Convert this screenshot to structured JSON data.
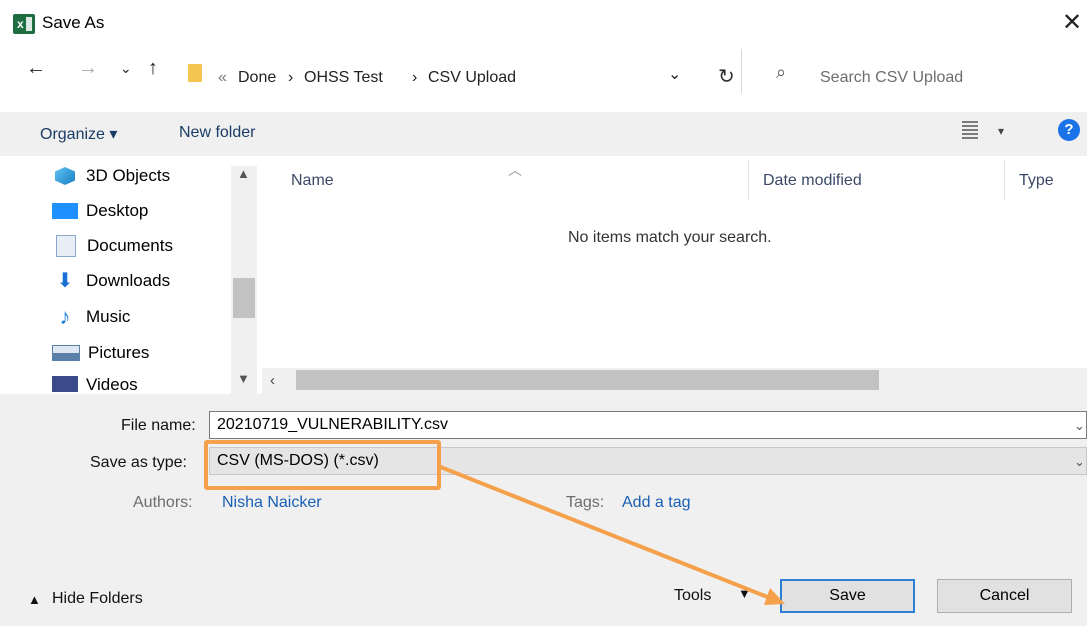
{
  "window": {
    "title": "Save As",
    "app_icon": "excel-icon",
    "close_glyph": "✕"
  },
  "nav": {
    "back": "←",
    "forward": "→",
    "recent": "⌄",
    "up": "↑",
    "breadcrumb_sep": "«",
    "crumbs": [
      "Done",
      "OHSS Test",
      "CSV Upload"
    ],
    "crumb_arrow": "›",
    "dropdown": "⌄",
    "refresh": "↻",
    "search_placeholder": "Search CSV Upload"
  },
  "toolbar": {
    "organize": "Organize ▾",
    "new_folder": "New folder",
    "help": "?"
  },
  "sidebar": {
    "items": [
      {
        "label": "3D Objects",
        "icon": "3d-objects-icon",
        "color": "#2b9fd8"
      },
      {
        "label": "Desktop",
        "icon": "desktop-icon",
        "color": "#1e90ff"
      },
      {
        "label": "Documents",
        "icon": "documents-icon",
        "color": "#8aa6c8"
      },
      {
        "label": "Downloads",
        "icon": "downloads-icon",
        "color": "#1a6fd4"
      },
      {
        "label": "Music",
        "icon": "music-icon",
        "color": "#1e7fd8"
      },
      {
        "label": "Pictures",
        "icon": "pictures-icon",
        "color": "#5a7fa8"
      },
      {
        "label": "Videos",
        "icon": "videos-icon",
        "color": "#3a4a8a"
      }
    ]
  },
  "filelist": {
    "columns": [
      "Name",
      "Date modified",
      "Type"
    ],
    "empty_message": "No items match your search."
  },
  "form": {
    "file_name_label": "File name:",
    "file_name_value": "20210719_VULNERABILITY.csv",
    "save_type_label": "Save as type:",
    "save_type_value": "CSV (MS-DOS) (*.csv)",
    "authors_label": "Authors:",
    "authors_value": "Nisha Naicker",
    "tags_label": "Tags:",
    "tags_value": "Add a tag"
  },
  "footer": {
    "hide_folders": "Hide Folders",
    "tools": "Tools",
    "save": "Save",
    "cancel": "Cancel"
  },
  "colors": {
    "annotation": "#f5a04a",
    "accent": "#2a7fd4"
  }
}
